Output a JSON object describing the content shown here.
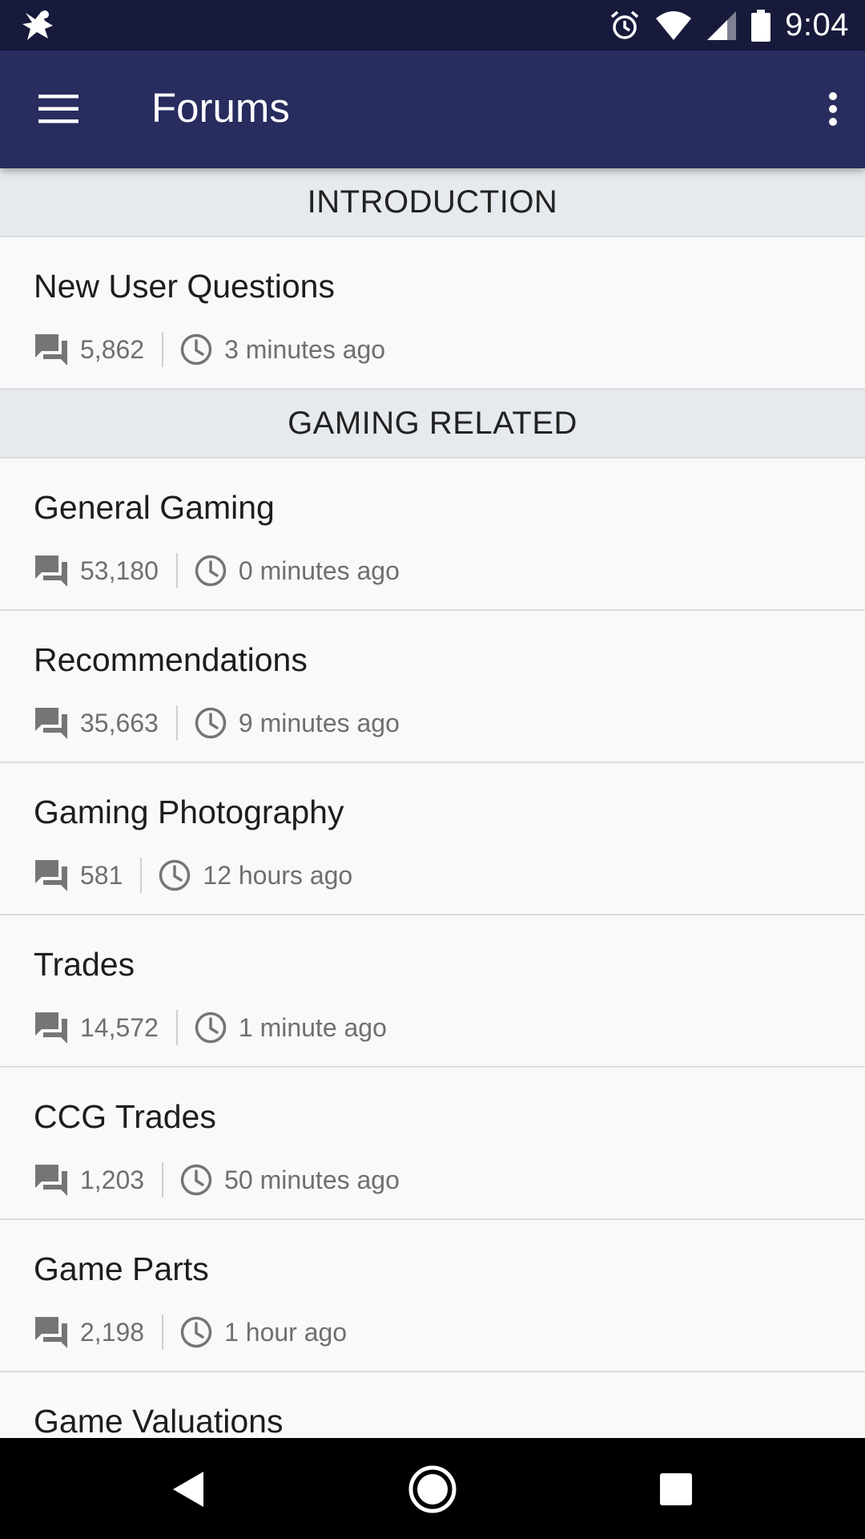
{
  "status_bar": {
    "time": "9:04",
    "icons": [
      "notification-app-icon",
      "alarm-icon",
      "wifi-icon",
      "cell-signal-icon",
      "battery-icon"
    ]
  },
  "app_bar": {
    "title": "Forums",
    "icons": [
      "menu-icon",
      "overflow-menu-icon"
    ],
    "background": "#282c5e"
  },
  "sections": [
    {
      "header": "INTRODUCTION",
      "forums": [
        {
          "name": "New User Questions",
          "count": "5,862",
          "last_activity": "3 minutes ago"
        }
      ]
    },
    {
      "header": "GAMING RELATED",
      "forums": [
        {
          "name": "General Gaming",
          "count": "53,180",
          "last_activity": "0 minutes ago"
        },
        {
          "name": "Recommendations",
          "count": "35,663",
          "last_activity": "9 minutes ago"
        },
        {
          "name": "Gaming Photography",
          "count": "581",
          "last_activity": "12 hours ago"
        },
        {
          "name": "Trades",
          "count": "14,572",
          "last_activity": "1 minute ago"
        },
        {
          "name": "CCG Trades",
          "count": "1,203",
          "last_activity": "50 minutes ago"
        },
        {
          "name": "Game Parts",
          "count": "2,198",
          "last_activity": "1 hour ago"
        },
        {
          "name": "Game Valuations",
          "count": "",
          "last_activity": ""
        }
      ]
    }
  ],
  "nav_bar": {
    "icons": [
      "back-icon",
      "home-icon",
      "recents-icon"
    ]
  }
}
